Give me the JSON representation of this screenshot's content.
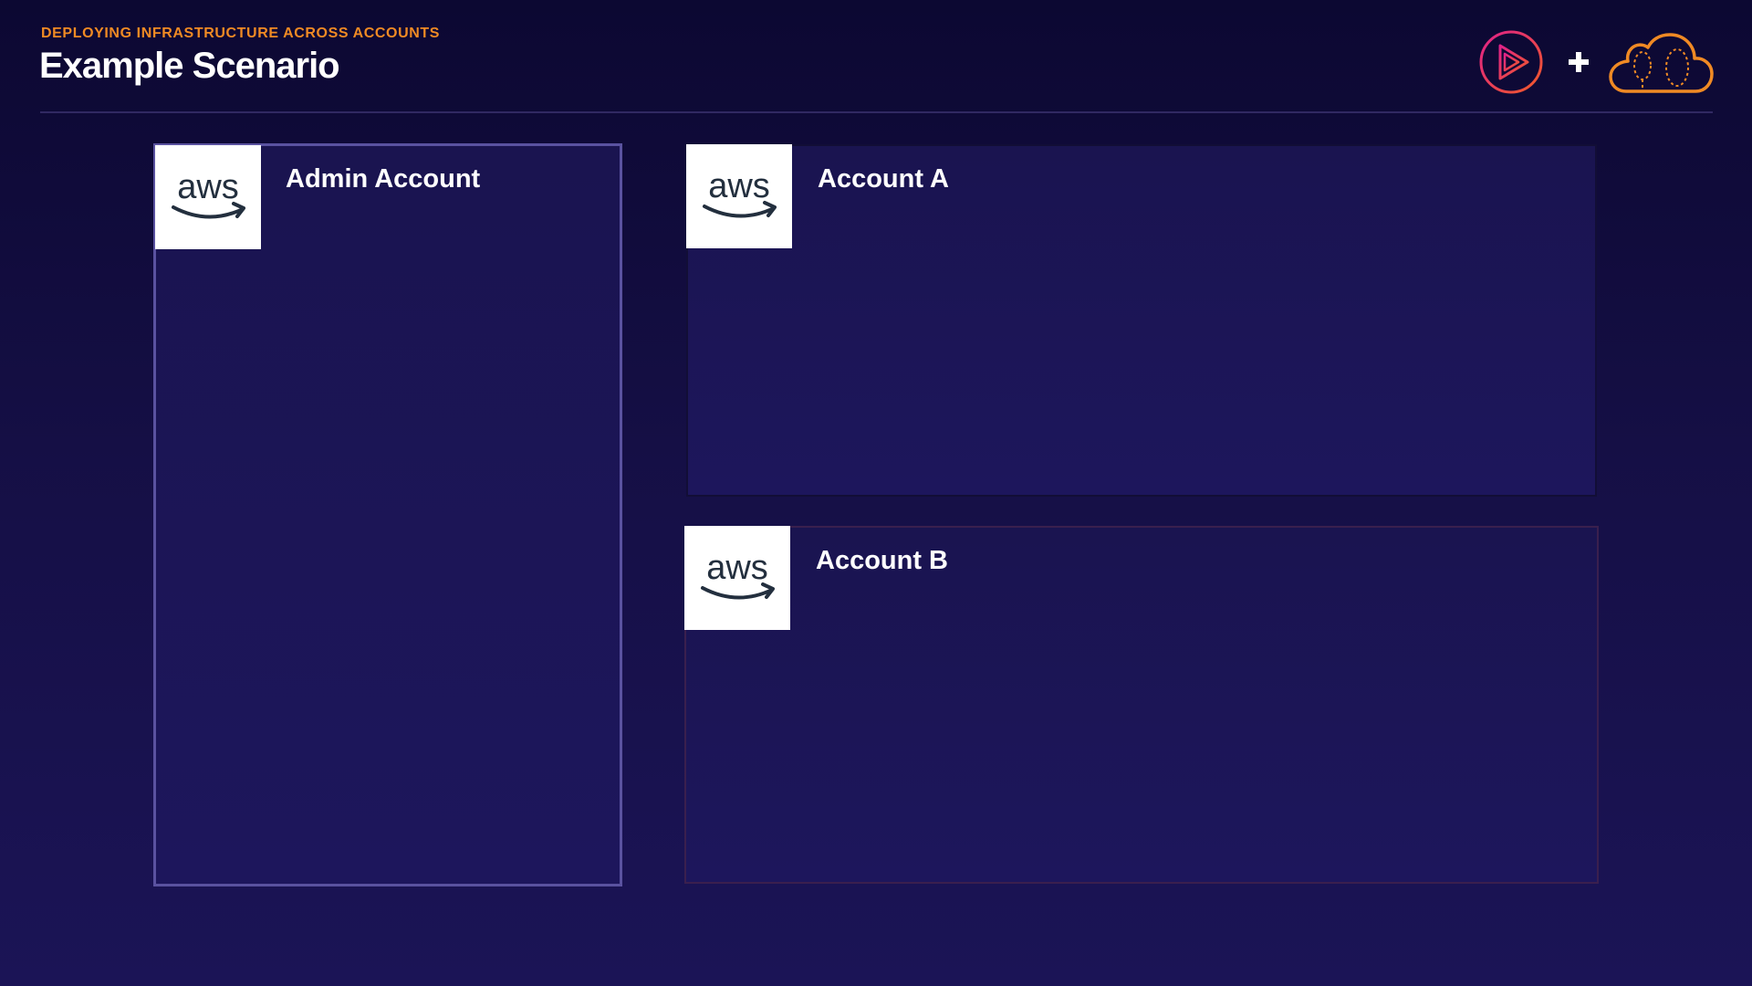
{
  "header": {
    "subtitle": "DEPLOYING INFRASTRUCTURE ACROSS ACCOUNTS",
    "title": "Example Scenario",
    "logo_separator": "+"
  },
  "logos": {
    "left_icon": "play-triangle-icon",
    "right_icon": "cloud-icon",
    "colors": {
      "play_gradient_start": "#e0218a",
      "play_gradient_end": "#f05a28",
      "cloud": "#f08a24"
    }
  },
  "accounts": [
    {
      "logo_text": "aws",
      "label": "Admin Account"
    },
    {
      "logo_text": "aws",
      "label": "Account A"
    },
    {
      "logo_text": "aws",
      "label": "Account B"
    }
  ],
  "colors": {
    "background": "#150f45",
    "subtitle": "#f08a24",
    "admin_border": "#5a52a0"
  }
}
